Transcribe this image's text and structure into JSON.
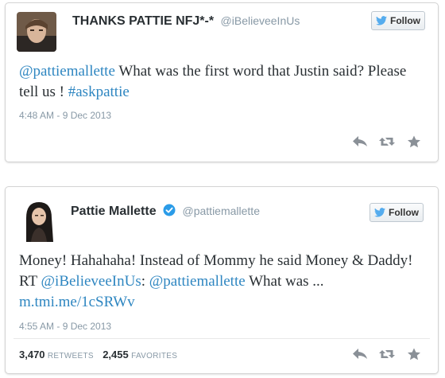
{
  "colors": {
    "link": "#2e86c1",
    "text": "#292f33",
    "muted": "#8899a6",
    "twitter_bird": "#55acee",
    "verified": "#2b9ce8"
  },
  "tweets": [
    {
      "display_name": "THANKS PATTIE NFJ*-*",
      "handle": "@iBelieveeInUs",
      "follow_label": "Follow",
      "text_1": "@pattiemallette",
      "text_2": " What was the first word that Justin said? Please tell us ! ",
      "text_3": "#askpattie",
      "timestamp": "4:48 AM - 9 Dec 2013"
    },
    {
      "display_name": "Pattie Mallette",
      "handle": "@pattiemallette",
      "follow_label": "Follow",
      "text_1": "Money! Hahahaha! Instead of Mommy he said Money & Daddy! RT ",
      "text_2": "@iBelieveeInUs",
      "text_3": ": ",
      "text_4": "@pattiemallette",
      "text_5": " What was ...",
      "text_6": "m.tmi.me/1cSRWv",
      "timestamp": "4:55 AM - 9 Dec 2013",
      "retweets_count": "3,470",
      "retweets_label": "RETWEETS",
      "favorites_count": "2,455",
      "favorites_label": "FAVORITES"
    }
  ],
  "icons": [
    "avatar",
    "twitter-bird-icon",
    "verified-badge-icon",
    "reply-icon",
    "retweet-icon",
    "favorite-star-icon"
  ]
}
